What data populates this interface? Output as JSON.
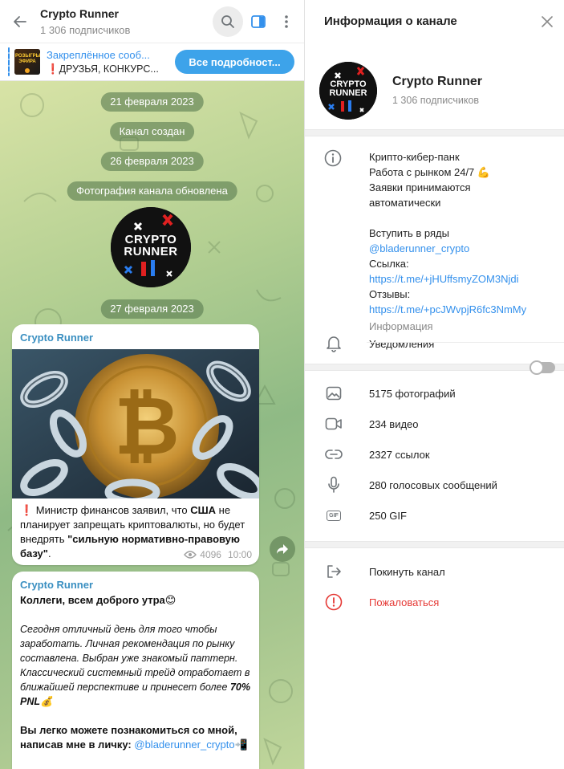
{
  "header": {
    "title": "Crypto Runner",
    "subtitle": "1 306 подписчиков"
  },
  "pinned": {
    "title": "Закреплённое сооб...",
    "desc": "❗ДРУЗЬЯ, КОНКУРС...",
    "thumb_text": "РОЗЫГРЫШ ЭФИРА",
    "button": "Все подробност..."
  },
  "chat": {
    "dates": [
      "21 февраля 2023",
      "Канал создан",
      "26 февраля 2023",
      "Фотография канала обновлена",
      "27 февраля 2023"
    ],
    "logo_line1": "CRYPTO",
    "logo_line2": "RUNNER",
    "messages": [
      {
        "author": "Crypto Runner",
        "text_prefix": "❗ Министр финансов заявил, что ",
        "bold1": "США",
        "text_mid": " не планирует запрещать криптовалюты, но будет внедрять ",
        "bold2": "\"сильную нормативно-правовую базу\"",
        "text_end": ".",
        "views": "4096",
        "time": "10:00"
      },
      {
        "author": "Crypto Runner",
        "greeting": "Коллеги, всем доброго утра😊",
        "italic_prefix": "Сегодня отличный день для того чтобы заработать. Личная рекомендация по рынку составлена. Выбран уже знакомый паттерн. Классический системный трейд отработает в ближайшей перспективе и принесет более ",
        "italic_bold": "70% PNL",
        "italic_emoji": "💰",
        "contact_text": "Вы легко можете познакомиться со мной, написав мне в личку: ",
        "contact_link": "@bladerunner_crypto",
        "contact_emoji": "📲"
      }
    ]
  },
  "info": {
    "title": "Информация о канале",
    "name": "Crypto Runner",
    "subscribers": "1 306 подписчиков",
    "description": {
      "line1": "Крипто-кибер-панк",
      "line2": "Работа с рынком 24/7 💪",
      "line3": "Заявки принимаются",
      "line4": "автоматически",
      "line5": "Вступить в ряды",
      "handle": "@bladerunner_crypto",
      "link_label": "Ссылка:",
      "link1": "https://t.me/+jHUffsmyZOM3Njdi",
      "reviews_label": "Отзывы:",
      "link2": "https://t.me/+pcJWvpjR6fc3NmMy",
      "caption": "Информация"
    },
    "notifications": "Уведомления",
    "media": {
      "photos": "5175 фотографий",
      "videos": "234 видео",
      "links": "2327 ссылок",
      "voice": "280 голосовых сообщений",
      "gif": "250 GIF"
    },
    "gif_badge": "GIF",
    "leave": "Покинуть канал",
    "report": "Пожаловаться"
  },
  "colors": {
    "accent": "#3390ec",
    "danger": "#e53935",
    "author": "#3a8fc1"
  }
}
